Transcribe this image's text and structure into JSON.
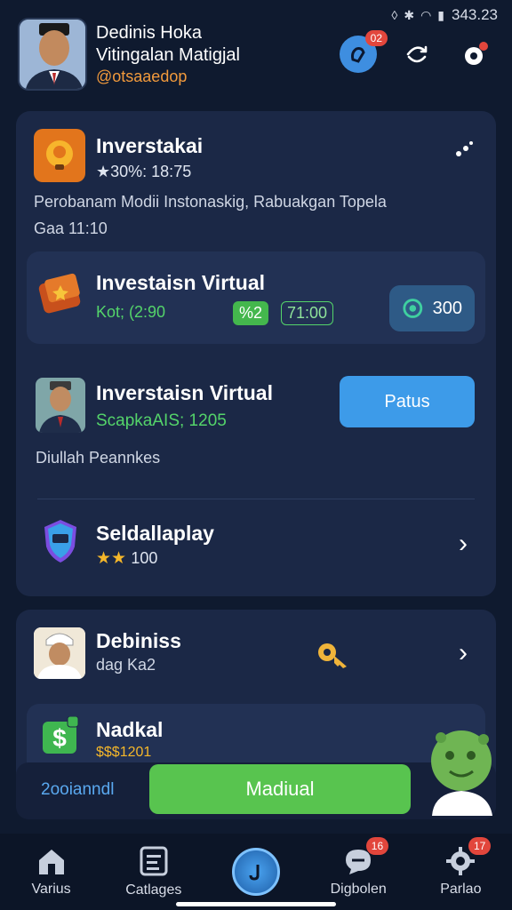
{
  "status_bar": {
    "time": "343.23"
  },
  "header": {
    "title_line1": "Dedinis Hoka",
    "title_line2": "Vitingalan Matigjal",
    "handle": "@otsaaedop",
    "notification_badge": "02"
  },
  "card_top": {
    "title": "Inverstakai",
    "rating": "★30%: 18:75",
    "description": "Perobanam Modii Instonaskig, Rabuakgan Topela",
    "meta": "Gaa 11:10"
  },
  "investment_row": {
    "title": "Investaisn Virtual",
    "sub": "Kot; (2:90",
    "pill_green": "%2",
    "pill_outline": "71:00",
    "chip_value": "300"
  },
  "profile_row": {
    "title": "Inverstaisn Virtual",
    "sub": "ScapkaAIS; 1205",
    "button": "Patus",
    "note": "Diullah Peannkes"
  },
  "badge_row": {
    "title": "Seldallaplay",
    "stars": "★★",
    "value": "100"
  },
  "card_bottom": {
    "row1": {
      "title": "Debiniss",
      "sub": "dag Ka2"
    },
    "row2": {
      "title": "Nadkal",
      "sub": "$$$1201"
    }
  },
  "bottom_bar": {
    "left_label": "2ooianndl",
    "button": "Madiual"
  },
  "nav": {
    "items": [
      {
        "label": "Varius"
      },
      {
        "label": "Catlages"
      },
      {
        "label": ""
      },
      {
        "label": "Digbolen",
        "badge": "16"
      },
      {
        "label": "Parlao",
        "badge": "17"
      }
    ]
  },
  "colors": {
    "background": "#0f1a2f",
    "card": "#1b2846",
    "accent_blue": "#3d9be9",
    "accent_green": "#58c44f",
    "badge_red": "#e2463c",
    "handle_orange": "#f29a3c"
  }
}
